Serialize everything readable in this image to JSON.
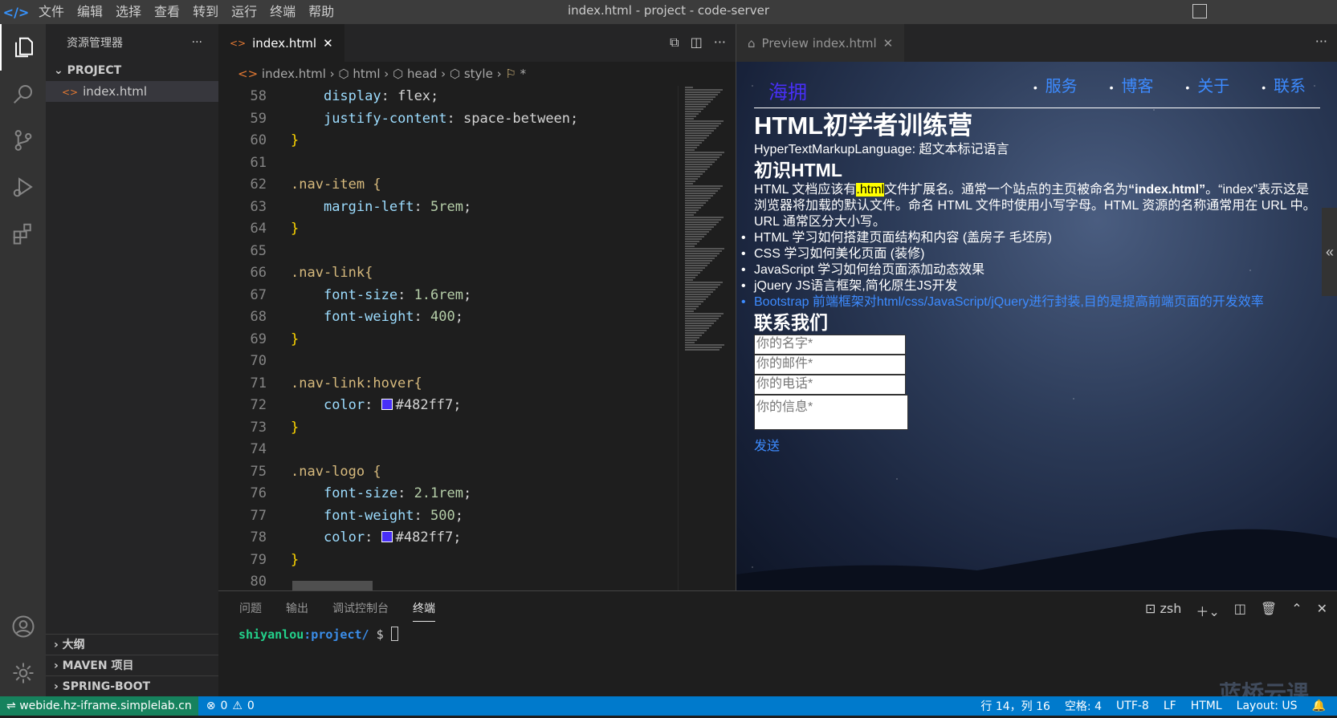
{
  "titlebar": {
    "menu": [
      "文件",
      "编辑",
      "选择",
      "查看",
      "转到",
      "运行",
      "终端",
      "帮助"
    ],
    "title": "index.html - project - code-server"
  },
  "sidebar": {
    "title": "资源管理器",
    "more": "···",
    "project": "PROJECT",
    "file": "index.html",
    "sections": [
      "大纲",
      "MAVEN 项目",
      "SPRING-BOOT DASHBO..."
    ]
  },
  "editor": {
    "tab": "index.html",
    "breadcrumb": [
      "index.html",
      "html",
      "head",
      "style",
      "*"
    ],
    "lines": [
      {
        "n": "58",
        "indent": 1,
        "prop": "display",
        "val": "flex",
        "kind": "kv"
      },
      {
        "n": "59",
        "indent": 1,
        "prop": "justify-content",
        "val": "space-between",
        "kind": "kv"
      },
      {
        "n": "60",
        "kind": "close"
      },
      {
        "n": "61",
        "kind": "blank"
      },
      {
        "n": "62",
        "sel": ".nav-item {",
        "kind": "sel"
      },
      {
        "n": "63",
        "indent": 1,
        "prop": "margin-left",
        "val": "5rem",
        "kind": "kvnum"
      },
      {
        "n": "64",
        "kind": "close"
      },
      {
        "n": "65",
        "kind": "blank"
      },
      {
        "n": "66",
        "sel": ".nav-link{",
        "kind": "sel"
      },
      {
        "n": "67",
        "indent": 1,
        "prop": "font-size",
        "val": "1.6rem",
        "kind": "kvnum"
      },
      {
        "n": "68",
        "indent": 1,
        "prop": "font-weight",
        "val": "400",
        "kind": "kvnum"
      },
      {
        "n": "69",
        "kind": "close"
      },
      {
        "n": "70",
        "kind": "blank"
      },
      {
        "n": "71",
        "sel": ".nav-link:hover{",
        "kind": "sel"
      },
      {
        "n": "72",
        "indent": 1,
        "prop": "color",
        "val": "#482ff7",
        "kind": "color"
      },
      {
        "n": "73",
        "kind": "close"
      },
      {
        "n": "74",
        "kind": "blank"
      },
      {
        "n": "75",
        "sel": ".nav-logo {",
        "kind": "sel"
      },
      {
        "n": "76",
        "indent": 1,
        "prop": "font-size",
        "val": "2.1rem",
        "kind": "kvnum"
      },
      {
        "n": "77",
        "indent": 1,
        "prop": "font-weight",
        "val": "500",
        "kind": "kvnum"
      },
      {
        "n": "78",
        "indent": 1,
        "prop": "color",
        "val": "#482ff7",
        "kind": "color"
      },
      {
        "n": "79",
        "kind": "close"
      },
      {
        "n": "80",
        "kind": "blank"
      }
    ]
  },
  "preview": {
    "tab": "Preview index.html",
    "logo": "海拥",
    "nav": [
      "服务",
      "博客",
      "关于",
      "联系"
    ],
    "h1": "HTML初学者训练营",
    "subtitle": "HyperTextMarkupLanguage: 超文本标记语言",
    "h2": "初识HTML",
    "para_before": "HTML 文档应该有",
    "para_mark": ".html",
    "para_after": "文件扩展名。通常一个站点的主页被命名为",
    "para_bold": "“index.html”",
    "para_rest": "。“index”表示这是浏览器将加载的默认文件。命名 HTML 文件时使用小写字母。HTML 资源的名称通常用在 URL 中。 URL 通常区分大小写。",
    "list": [
      "HTML 学习如何搭建页面结构和内容 (盖房子 毛坯房)",
      "CSS 学习如何美化页面 (装修)",
      "JavaScript 学习如何给页面添加动态效果",
      "jQuery JS语言框架,简化原生JS开发"
    ],
    "list_link": "Bootstrap 前端框架对html/css/JavaScript/jQuery进行封装,目的是提高前端页面的开发效率",
    "contact_title": "联系我们",
    "form": {
      "name": "你的名字*",
      "email": "你的邮件*",
      "phone": "你的电话*",
      "message": "你的信息*",
      "send": "发送"
    }
  },
  "panel": {
    "tabs": [
      "问题",
      "输出",
      "调试控制台",
      "终端"
    ],
    "shell": "zsh",
    "user": "shiyanlou",
    "path": ":project/",
    "prompt": " $ "
  },
  "status": {
    "remote": "webide.hz-iframe.simplelab.cn",
    "errors": "0",
    "warnings": "0",
    "position": "行 14，列 16",
    "spaces": "空格: 4",
    "encoding": "UTF-8",
    "eol": "LF",
    "language": "HTML",
    "layout": "Layout: US"
  },
  "watermark": "蓝桥云课",
  "colors": {
    "accent": "#482ff7",
    "status": "#007acc",
    "remote": "#16825d"
  }
}
